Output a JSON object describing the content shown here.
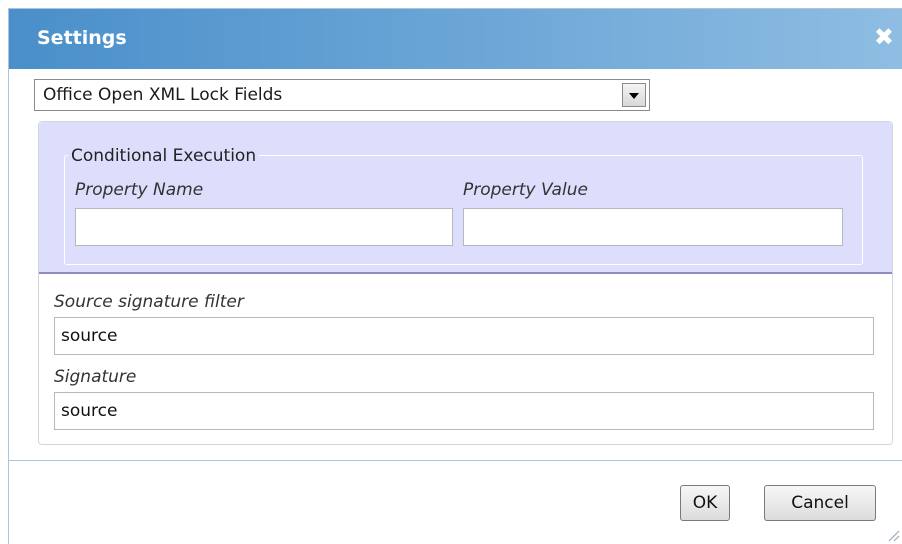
{
  "dialog": {
    "title": "Settings",
    "close_icon": "close-icon"
  },
  "type_select": {
    "value": "Office Open XML Lock Fields"
  },
  "conditional_execution": {
    "legend": "Conditional Execution",
    "property_name_label": "Property Name",
    "property_name_value": "",
    "property_value_label": "Property Value",
    "property_value_value": ""
  },
  "source_signature_filter": {
    "label": "Source signature filter",
    "value": "source"
  },
  "signature": {
    "label": "Signature",
    "value": "source"
  },
  "buttons": {
    "ok": "OK",
    "cancel": "Cancel"
  },
  "colors": {
    "titlebar": "#4a8fca",
    "conditional_background": "#ddddfc"
  }
}
